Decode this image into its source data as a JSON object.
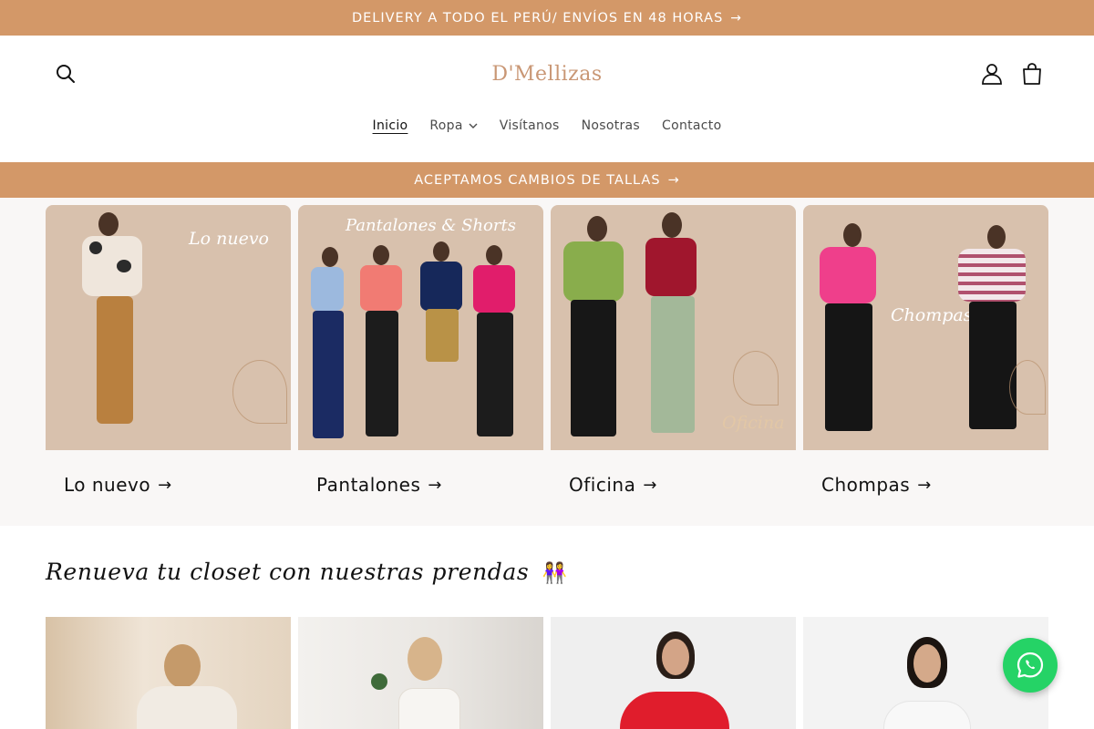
{
  "announcement_top": {
    "text": "DELIVERY A TODO EL PERÚ/ ENVÍOS EN 48 HORAS",
    "arrow": "→"
  },
  "header": {
    "logo_text": "D'Mellizas",
    "icons": {
      "search": "search-icon",
      "account": "user-icon",
      "cart": "shopping-bag-icon"
    }
  },
  "nav": {
    "items": [
      {
        "label": "Inicio",
        "active": true
      },
      {
        "label": "Ropa",
        "has_dropdown": true
      },
      {
        "label": "Visítanos"
      },
      {
        "label": "Nosotras"
      },
      {
        "label": "Contacto"
      }
    ]
  },
  "announcement_second": {
    "text": "ACEPTAMOS CAMBIOS DE TALLAS",
    "arrow": "→"
  },
  "collections": [
    {
      "image_text": "Lo nuevo",
      "label": "Lo nuevo",
      "arrow": "→"
    },
    {
      "image_text": "Pantalones & Shorts",
      "label": "Pantalones",
      "arrow": "→"
    },
    {
      "image_text": "Oficina",
      "label": "Oficina",
      "arrow": "→"
    },
    {
      "image_text": "Chompas",
      "label": "Chompas",
      "arrow": "→"
    }
  ],
  "products_section": {
    "title": "Renueva tu closet con nuestras prendas",
    "emoji": "👭"
  },
  "colors": {
    "accent": "#d39868",
    "image_bg": "#d8c1ad",
    "section_bg": "#f9f7f6",
    "whatsapp": "#25d366"
  },
  "whatsapp": {
    "icon": "whatsapp-icon"
  }
}
